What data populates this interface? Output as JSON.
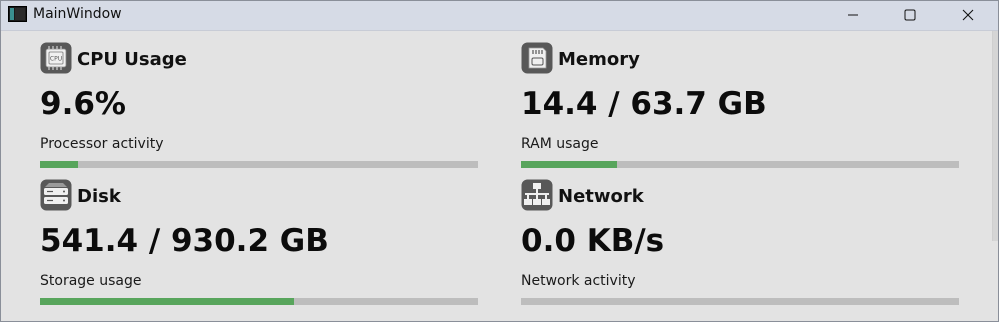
{
  "window": {
    "title": "MainWindow"
  },
  "cards": {
    "cpu": {
      "title": "CPU Usage",
      "value": "9.6%",
      "subtitle": "Processor activity",
      "progress": 0.087,
      "icon": "cpu-icon"
    },
    "memory": {
      "title": "Memory",
      "value": "14.4 / 63.7 GB",
      "subtitle": "RAM usage",
      "progress": 0.219,
      "icon": "memory-card-icon"
    },
    "disk": {
      "title": "Disk",
      "value": "541.4 / 930.2 GB",
      "subtitle": "Storage usage",
      "progress": 0.579,
      "icon": "hard-drive-icon"
    },
    "network": {
      "title": "Network",
      "value": "0.0 KB/s",
      "subtitle": "Network activity",
      "progress": 0.0,
      "icon": "network-icon"
    }
  },
  "colors": {
    "progress_fill": "#58a55c",
    "progress_track": "#bdbdbd",
    "background": "#e3e3e3",
    "icon_tile": "#585858"
  }
}
